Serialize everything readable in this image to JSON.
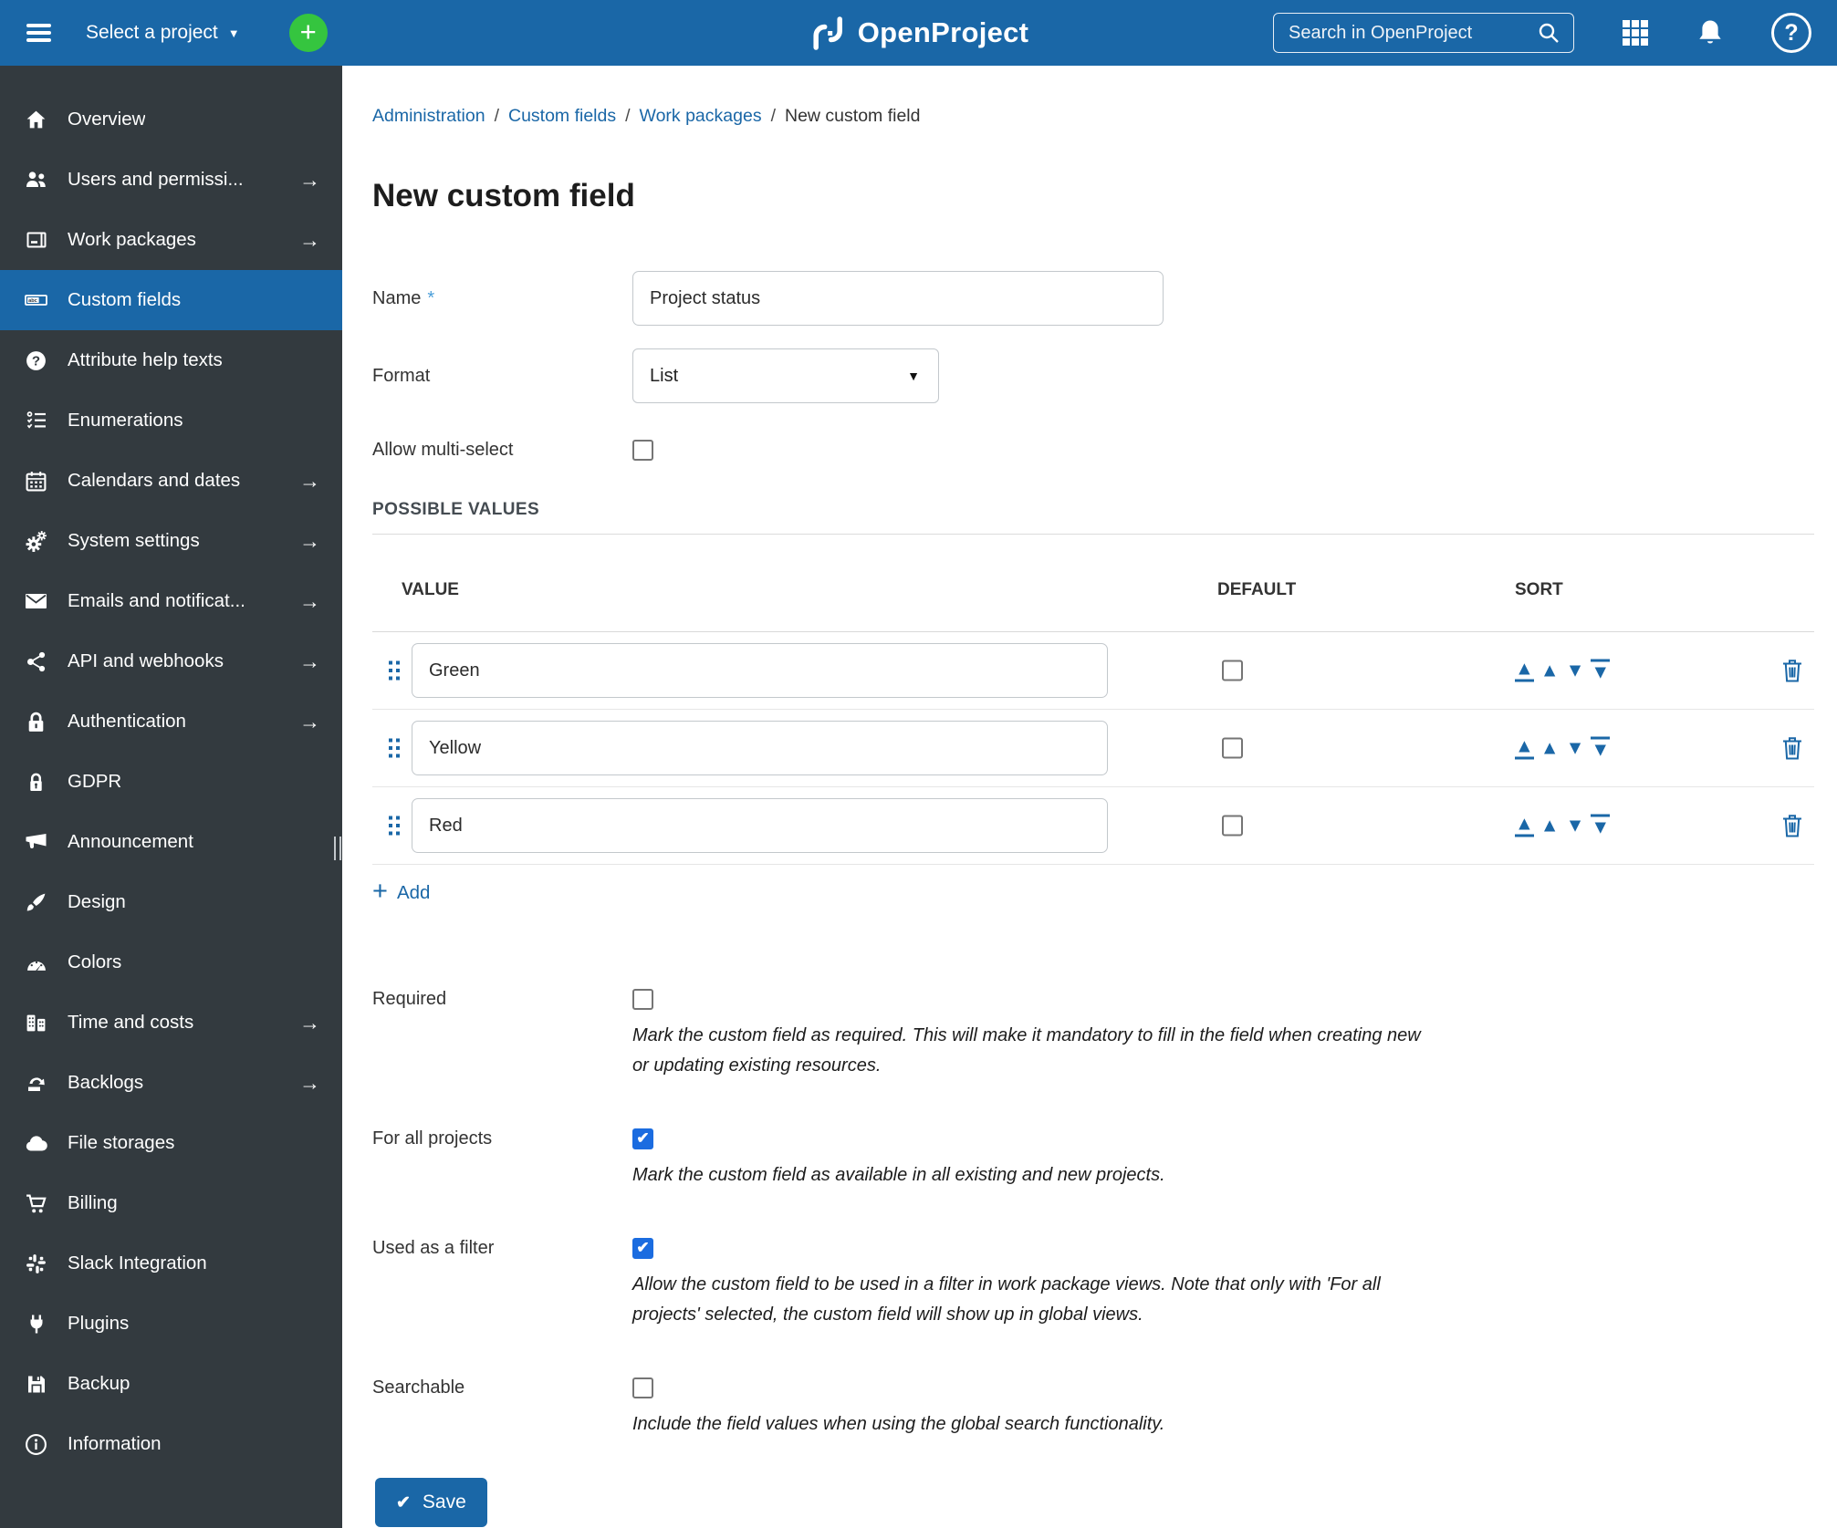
{
  "header": {
    "select_project_label": "Select a project",
    "logo_text": "OpenProject",
    "search_placeholder": "Search in OpenProject"
  },
  "sidebar": {
    "items": [
      {
        "label": "Overview",
        "icon": "home-icon",
        "arrow": false,
        "selected": false
      },
      {
        "label": "Users and permissi...",
        "icon": "users-icon",
        "arrow": true,
        "selected": false
      },
      {
        "label": "Work packages",
        "icon": "work-packages-icon",
        "arrow": true,
        "selected": false
      },
      {
        "label": "Custom fields",
        "icon": "custom-fields-icon",
        "arrow": false,
        "selected": true
      },
      {
        "label": "Attribute help texts",
        "icon": "help-circle-icon",
        "arrow": false,
        "selected": false
      },
      {
        "label": "Enumerations",
        "icon": "checklist-icon",
        "arrow": false,
        "selected": false
      },
      {
        "label": "Calendars and dates",
        "icon": "calendar-icon",
        "arrow": true,
        "selected": false
      },
      {
        "label": "System settings",
        "icon": "gears-icon",
        "arrow": true,
        "selected": false
      },
      {
        "label": "Emails and notificat...",
        "icon": "envelope-icon",
        "arrow": true,
        "selected": false
      },
      {
        "label": "API and webhooks",
        "icon": "share-nodes-icon",
        "arrow": true,
        "selected": false
      },
      {
        "label": "Authentication",
        "icon": "lock-icon",
        "arrow": true,
        "selected": false
      },
      {
        "label": "GDPR",
        "icon": "lock-shield-icon",
        "arrow": false,
        "selected": false
      },
      {
        "label": "Announcement",
        "icon": "megaphone-icon",
        "arrow": false,
        "selected": false
      },
      {
        "label": "Design",
        "icon": "brush-icon",
        "arrow": false,
        "selected": false
      },
      {
        "label": "Colors",
        "icon": "gauge-icon",
        "arrow": false,
        "selected": false
      },
      {
        "label": "Time and costs",
        "icon": "time-costs-icon",
        "arrow": true,
        "selected": false
      },
      {
        "label": "Backlogs",
        "icon": "backlogs-icon",
        "arrow": true,
        "selected": false
      },
      {
        "label": "File storages",
        "icon": "cloud-icon",
        "arrow": false,
        "selected": false
      },
      {
        "label": "Billing",
        "icon": "cart-icon",
        "arrow": false,
        "selected": false
      },
      {
        "label": "Slack Integration",
        "icon": "slack-icon",
        "arrow": false,
        "selected": false
      },
      {
        "label": "Plugins",
        "icon": "plug-icon",
        "arrow": false,
        "selected": false
      },
      {
        "label": "Backup",
        "icon": "floppy-icon",
        "arrow": false,
        "selected": false
      },
      {
        "label": "Information",
        "icon": "info-circle-icon",
        "arrow": false,
        "selected": false
      }
    ]
  },
  "breadcrumb": {
    "links": [
      "Administration",
      "Custom fields",
      "Work packages"
    ],
    "current": "New custom field",
    "separator": "/"
  },
  "page": {
    "title": "New custom field"
  },
  "form": {
    "name": {
      "label": "Name",
      "required_marker": "*",
      "value": "Project status"
    },
    "format": {
      "label": "Format",
      "value": "List"
    },
    "multi_select": {
      "label": "Allow multi-select",
      "checked": false
    },
    "possible_values": {
      "section_title": "POSSIBLE VALUES",
      "columns": {
        "value": "VALUE",
        "default": "DEFAULT",
        "sort": "SORT"
      },
      "rows": [
        {
          "value": "Green",
          "default_checked": false
        },
        {
          "value": "Yellow",
          "default_checked": false
        },
        {
          "value": "Red",
          "default_checked": false
        }
      ],
      "add_label": "Add"
    },
    "options": [
      {
        "label": "Required",
        "checked": false,
        "help": "Mark the custom field as required. This will make it mandatory to fill in the field when creating new or updating existing resources."
      },
      {
        "label": "For all projects",
        "checked": true,
        "help": "Mark the custom field as available in all existing and new projects."
      },
      {
        "label": "Used as a filter",
        "checked": true,
        "help": "Allow the custom field to be used in a filter in work package views. Note that only with 'For all projects' selected, the custom field will show up in global views."
      },
      {
        "label": "Searchable",
        "checked": false,
        "help": "Include the field values when using the global search functionality."
      }
    ],
    "save_label": "Save"
  },
  "colors": {
    "primary_blue": "#1A67A7",
    "sidebar_bg": "#333A3F",
    "accent_green": "#35C53F",
    "checkbox_checked_blue": "#1B6CE0",
    "link_blue": "#1A67A7",
    "required_marker_blue": "#4A9ED9"
  }
}
